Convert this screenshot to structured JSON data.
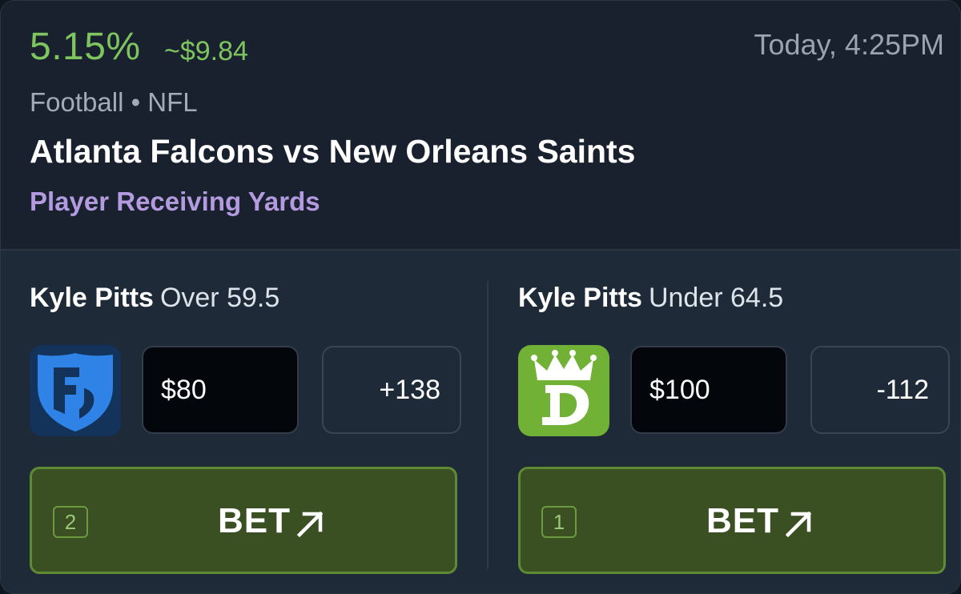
{
  "header": {
    "percent": "5.15%",
    "profit": "~$9.84",
    "time": "Today, 4:25PM",
    "league": "Football • NFL",
    "matchup": "Atlanta Falcons vs New Orleans Saints",
    "market": "Player Receiving Yards"
  },
  "colors": {
    "accent_green": "#7ec45f",
    "market_purple": "#b49be0",
    "bet_button_bg": "#3a5022",
    "bet_button_border": "#5f8a34"
  },
  "sides": [
    {
      "player": "Kyle Pitts",
      "line": "Over 59.5",
      "book_icon": "fanduel-logo-icon",
      "stake": "$80",
      "odds": "+138",
      "bet_label": "BET",
      "bet_count": "2"
    },
    {
      "player": "Kyle Pitts",
      "line": "Under 64.5",
      "book_icon": "draftkings-logo-icon",
      "stake": "$100",
      "odds": "-112",
      "bet_label": "BET",
      "bet_count": "1"
    }
  ]
}
